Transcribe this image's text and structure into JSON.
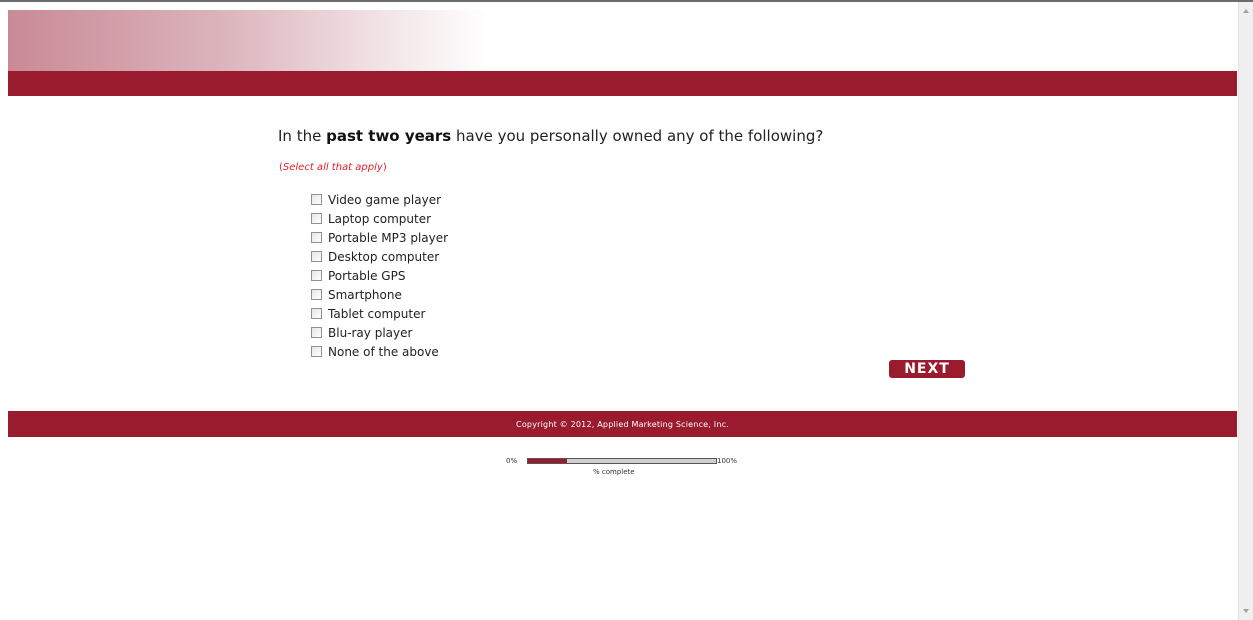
{
  "survey": {
    "question_prefix": "In the ",
    "question_bold": "past two years",
    "question_suffix": " have you personally owned any of the following?",
    "instruction_open": "(",
    "instruction_text": "Select all that apply",
    "instruction_close": ")",
    "options": [
      {
        "label": "Video game player",
        "checked": false
      },
      {
        "label": "Laptop computer",
        "checked": false
      },
      {
        "label": "Portable MP3 player",
        "checked": false
      },
      {
        "label": "Desktop computer",
        "checked": false
      },
      {
        "label": "Portable GPS",
        "checked": false
      },
      {
        "label": "Smartphone",
        "checked": false
      },
      {
        "label": "Tablet computer",
        "checked": false
      },
      {
        "label": "Blu-ray player",
        "checked": false
      },
      {
        "label": "None of the above",
        "checked": false
      }
    ],
    "next_label": "NEXT"
  },
  "footer": {
    "copyright": "Copyright © 2012, Applied Marketing Science, Inc."
  },
  "progress": {
    "start_label": "0%",
    "end_label": "100%",
    "caption": "% complete",
    "value": 0.21
  },
  "colors": {
    "brand": "#9b1b2e",
    "instruction": "#e0202a"
  }
}
